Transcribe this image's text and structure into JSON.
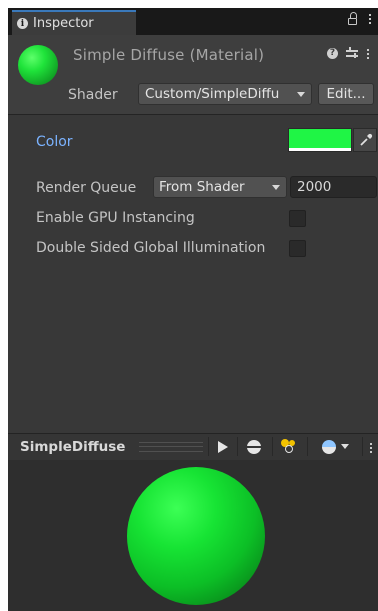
{
  "tab": {
    "title": "Inspector"
  },
  "material": {
    "title": "Simple Diffuse (Material)",
    "color": "#1ff545"
  },
  "shader": {
    "label": "Shader",
    "value": "Custom/SimpleDiffu",
    "edit_label": "Edit..."
  },
  "properties": {
    "color_label": "Color",
    "color_value": "#1ff545",
    "render_queue_label": "Render Queue",
    "render_queue_option": "From Shader",
    "render_queue_value": "2000",
    "gpu_instancing_label": "Enable GPU Instancing",
    "gpu_instancing_checked": false,
    "double_sided_gi_label": "Double Sided Global Illumination",
    "double_sided_gi_checked": false
  },
  "preview": {
    "title": "SimpleDiffuse"
  },
  "colors": {
    "accent_tab": "#3a79bb",
    "property_label_highlight": "#7bb3ff",
    "material_green": "#1ff545"
  },
  "icons": [
    "info-icon",
    "lock-icon",
    "more-menu-icon",
    "help-icon",
    "presets-icon",
    "eyedropper-icon",
    "play-icon",
    "sphere-mesh-icon",
    "light-icon",
    "background-icon",
    "chevron-down-icon"
  ]
}
